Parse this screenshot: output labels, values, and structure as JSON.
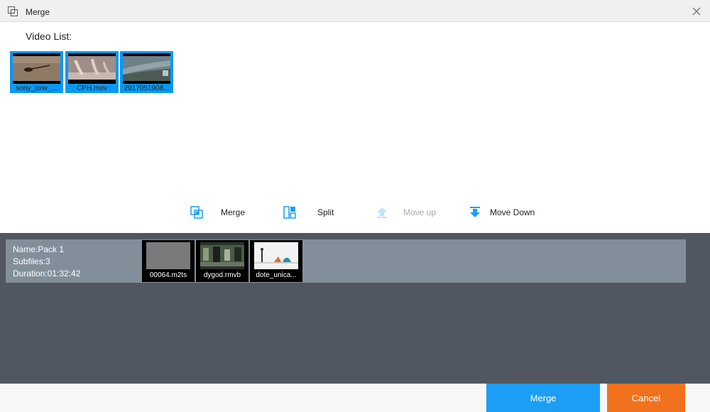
{
  "window": {
    "title": "Merge",
    "app_icon": "merge-window-icon",
    "close_icon": "close-icon"
  },
  "video_list": {
    "label": "Video List:",
    "items": [
      {
        "name": "sony_pxw_..."
      },
      {
        "name": "CPH.mov"
      },
      {
        "name": "2017051908..."
      }
    ]
  },
  "toolbar": {
    "merge_label": "Merge",
    "split_label": "Split",
    "move_up_label": "Move up",
    "move_down_label": "Move Down"
  },
  "pack": {
    "name": "Name:Pack 1",
    "subfiles": "Subfiles:3",
    "duration": "Duration:01:32:42",
    "items": [
      {
        "name": "00064.m2ts"
      },
      {
        "name": "dygod.rmvb"
      },
      {
        "name": "dote_unica..."
      }
    ]
  },
  "footer": {
    "merge_label": "Merge",
    "cancel_label": "Cancel"
  },
  "colors": {
    "accent_blue": "#1c9ef4",
    "selection_blue": "#0a98f2",
    "cancel_orange": "#f1711d",
    "panel_dark": "#515760",
    "pack_row": "#828f9b"
  }
}
